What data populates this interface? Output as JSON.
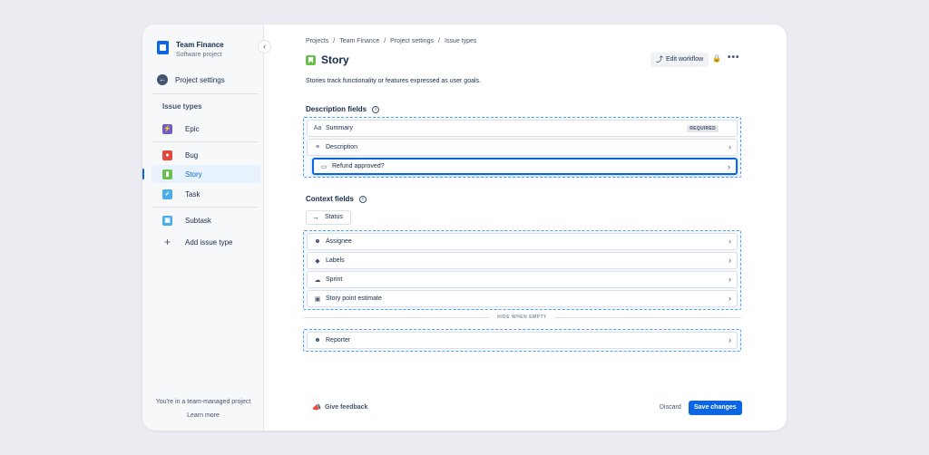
{
  "sidebar": {
    "project_name": "Team Finance",
    "project_type": "Software project",
    "back_label": "Project settings",
    "section_heading": "Issue types",
    "items": [
      {
        "label": "Epic",
        "color": "#6e5dc6",
        "icon": "lightning-icon"
      },
      {
        "label": "Bug",
        "color": "#e2483d",
        "icon": "bug-icon"
      },
      {
        "label": "Story",
        "color": "#6bbf4e",
        "icon": "bookmark-icon"
      },
      {
        "label": "Task",
        "color": "#4bade8",
        "icon": "check-icon"
      },
      {
        "label": "Subtask",
        "color": "#4bade8",
        "icon": "subtask-icon"
      },
      {
        "label": "Add issue type",
        "icon": "plus-icon"
      }
    ],
    "footer_text": "You're in a team-managed project",
    "footer_link": "Learn more"
  },
  "breadcrumbs": [
    "Projects",
    "Team Finance",
    "Project settings",
    "Issue types"
  ],
  "header": {
    "title": "Story",
    "edit_workflow": "Edit workflow",
    "description": "Stories track functionality or features expressed as user goals."
  },
  "description_fields": {
    "title": "Description fields",
    "fields": [
      {
        "label": "Summary",
        "icon": "text-icon",
        "badge": "REQUIRED"
      },
      {
        "label": "Description",
        "icon": "paragraph-icon"
      },
      {
        "label": "Refund approved?",
        "icon": "folder-icon"
      }
    ]
  },
  "context_fields": {
    "title": "Context fields",
    "status_label": "Status",
    "fields": [
      {
        "label": "Assignee",
        "icon": "person-icon"
      },
      {
        "label": "Labels",
        "icon": "tag-icon"
      },
      {
        "label": "Sprint",
        "icon": "sprint-icon"
      },
      {
        "label": "Story point estimate",
        "icon": "estimate-icon"
      }
    ],
    "hide_when_empty": "HIDE WHEN EMPTY",
    "hidden_fields": [
      {
        "label": "Reporter",
        "icon": "person-icon"
      }
    ]
  },
  "footer": {
    "feedback": "Give feedback",
    "discard": "Discard",
    "save": "Save changes"
  }
}
